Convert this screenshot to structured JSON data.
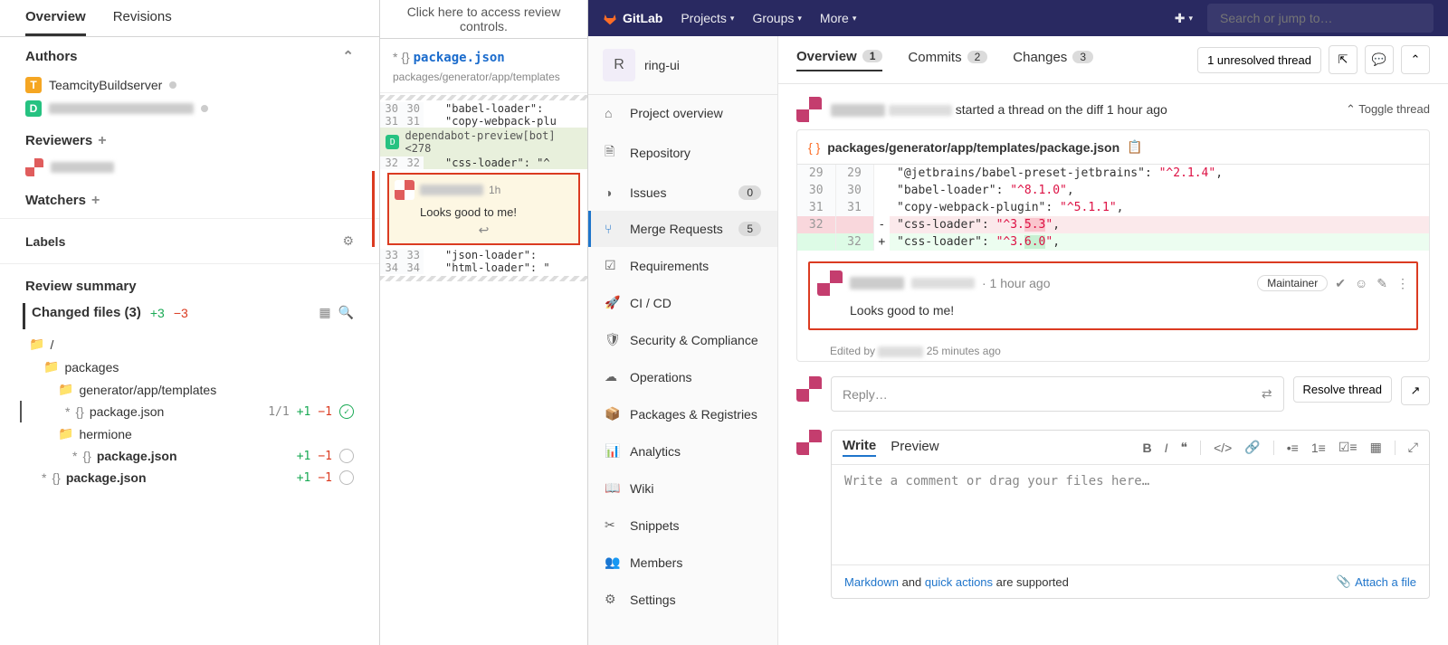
{
  "ide": {
    "tabs": [
      "Overview",
      "Revisions"
    ],
    "authors_title": "Authors",
    "author1": "TeamcityBuildserver",
    "reviewers_title": "Reviewers",
    "watchers_title": "Watchers",
    "labels_title": "Labels",
    "review_summary": "Review summary",
    "changed_files": "Changed files (3)",
    "cf_plus": "+3",
    "cf_minus": "−3",
    "tree": {
      "root": "/",
      "packages": "packages",
      "templates": "generator/app/templates",
      "pkg_json": "package.json",
      "hermione": "hermione",
      "ratio": "1/1",
      "p1": "+1",
      "m1": "−1"
    }
  },
  "diff": {
    "banner": "Click here to access review controls.",
    "file": "package.json",
    "path": "packages/generator/app/templates",
    "rows": [
      {
        "a": "30",
        "b": "30",
        "code": "\"babel-loader\":"
      },
      {
        "a": "31",
        "b": "31",
        "code": "\"copy-webpack-plu"
      }
    ],
    "commit": "dependabot-preview[bot] <278",
    "row32": {
      "a": "32",
      "b": "32",
      "code": "\"css-loader\": \"^"
    },
    "comment": {
      "time": "1h",
      "body": "Looks good to me!"
    },
    "row33": {
      "a": "33",
      "b": "33",
      "code": "\"json-loader\":"
    },
    "row34": {
      "a": "34",
      "b": "34",
      "code": "\"html-loader\": \""
    }
  },
  "gitlab": {
    "brand": "GitLab",
    "nav": {
      "projects": "Projects",
      "groups": "Groups",
      "more": "More"
    },
    "search_ph": "Search or jump to…",
    "project": {
      "letter": "R",
      "name": "ring-ui"
    },
    "menu": {
      "overview": "Project overview",
      "repo": "Repository",
      "issues": "Issues",
      "issues_n": "0",
      "mr": "Merge Requests",
      "mr_n": "5",
      "req": "Requirements",
      "cicd": "CI / CD",
      "sec": "Security & Compliance",
      "ops": "Operations",
      "pkg": "Packages & Registries",
      "analytics": "Analytics",
      "wiki": "Wiki",
      "snippets": "Snippets",
      "members": "Members",
      "settings": "Settings"
    },
    "mr_tabs": {
      "overview": "Overview",
      "overview_n": "1",
      "commits": "Commits",
      "commits_n": "2",
      "changes": "Changes",
      "changes_n": "3"
    },
    "unresolved": "1 unresolved thread",
    "thread": {
      "started": "started a thread on the diff",
      "when": "1 hour ago",
      "toggle": "Toggle thread"
    },
    "card": {
      "path": "packages/generator/app/templates/package.json",
      "lines": [
        {
          "a": "29",
          "b": "29",
          "k": "\"@jetbrains/babel-preset-jetbrains\"",
          "v": "\"^2.1.4\""
        },
        {
          "a": "30",
          "b": "30",
          "k": "\"babel-loader\"",
          "v": "\"^8.1.0\""
        },
        {
          "a": "31",
          "b": "31",
          "k": "\"copy-webpack-plugin\"",
          "v": "\"^5.1.1\""
        }
      ],
      "del": {
        "a": "32",
        "b": "",
        "k": "\"css-loader\"",
        "va": "\"^3.",
        "vhl": "5.3",
        "vb": "\""
      },
      "add": {
        "a": "",
        "b": "32",
        "k": "\"css-loader\"",
        "va": "\"^3.",
        "vhl": "6.0",
        "vb": "\""
      }
    },
    "discussion": {
      "time": "· 1 hour ago",
      "role": "Maintainer",
      "body": "Looks good to me!",
      "edited_prefix": "Edited by",
      "edited_time": "25 minutes ago"
    },
    "reply_ph": "Reply…",
    "resolve": "Resolve thread",
    "editor": {
      "write": "Write",
      "preview": "Preview",
      "placeholder": "Write a comment or drag your files here…",
      "md": "Markdown",
      "and": " and ",
      "qa": "quick actions",
      "supported": " are supported",
      "attach": "Attach a file"
    }
  }
}
